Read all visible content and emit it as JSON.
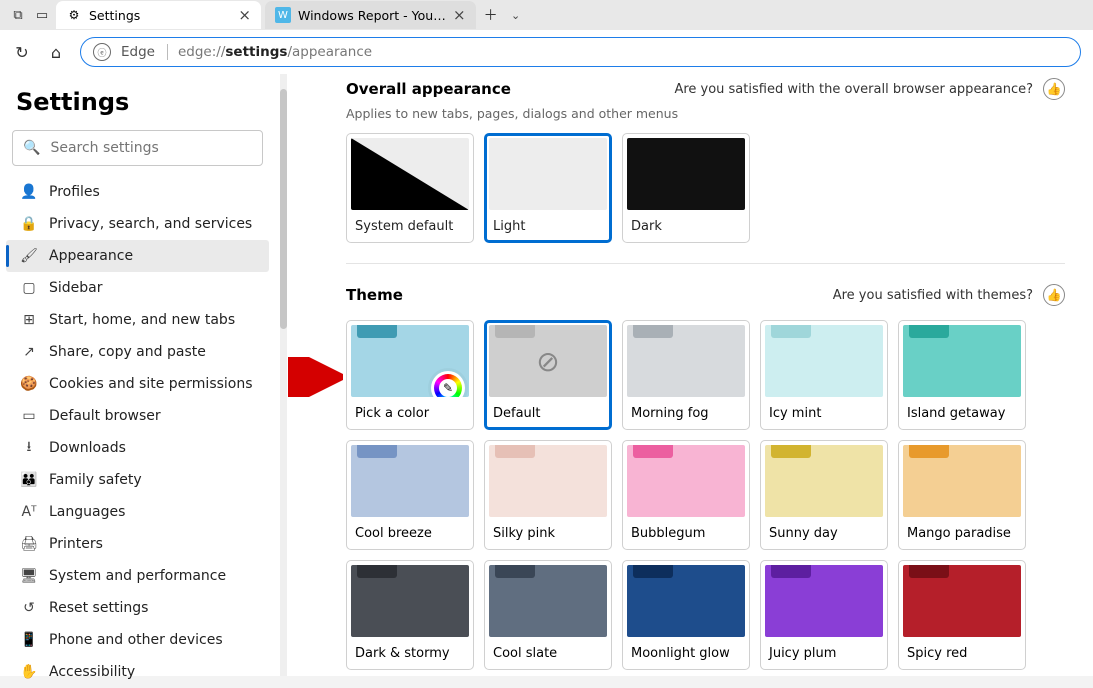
{
  "tabs": [
    {
      "title": "Settings",
      "active": true
    },
    {
      "title": "Windows Report - Your go-to so",
      "active": false
    }
  ],
  "url": {
    "prefix_label": "Edge",
    "scheme": "edge://",
    "bold": "settings",
    "rest": "/appearance"
  },
  "sidebar": {
    "title": "Settings",
    "search_placeholder": "Search settings",
    "items": [
      {
        "label": "Profiles"
      },
      {
        "label": "Privacy, search, and services"
      },
      {
        "label": "Appearance",
        "active": true
      },
      {
        "label": "Sidebar"
      },
      {
        "label": "Start, home, and new tabs"
      },
      {
        "label": "Share, copy and paste"
      },
      {
        "label": "Cookies and site permissions"
      },
      {
        "label": "Default browser"
      },
      {
        "label": "Downloads"
      },
      {
        "label": "Family safety"
      },
      {
        "label": "Languages"
      },
      {
        "label": "Printers"
      },
      {
        "label": "System and performance"
      },
      {
        "label": "Reset settings"
      },
      {
        "label": "Phone and other devices"
      },
      {
        "label": "Accessibility"
      }
    ]
  },
  "overall": {
    "title": "Overall appearance",
    "feedback": "Are you satisfied with the overall browser appearance?",
    "subtitle": "Applies to new tabs, pages, dialogs and other menus",
    "options": [
      {
        "label": "System default"
      },
      {
        "label": "Light",
        "selected": true
      },
      {
        "label": "Dark"
      }
    ]
  },
  "theme": {
    "title": "Theme",
    "feedback": "Are you satisfied with themes?",
    "items": [
      {
        "label": "Pick a color",
        "bg": "#a4d6e6",
        "tab": "#3f9bb3",
        "picker": true
      },
      {
        "label": "Default",
        "bg": "#cfcfcf",
        "tab": "#b5b5b5",
        "nope": true,
        "selected": true
      },
      {
        "label": "Morning fog",
        "bg": "#d7dadd",
        "tab": "#a9b0b6"
      },
      {
        "label": "Icy mint",
        "bg": "#cdeef0",
        "tab": "#9fd6da"
      },
      {
        "label": "Island getaway",
        "bg": "#69d0c6",
        "tab": "#2aa99c"
      },
      {
        "label": "Cool breeze",
        "bg": "#b4c6e0",
        "tab": "#7694c4"
      },
      {
        "label": "Silky pink",
        "bg": "#f4e1db",
        "tab": "#e6c0b6"
      },
      {
        "label": "Bubblegum",
        "bg": "#f8b4d3",
        "tab": "#ec5fa0"
      },
      {
        "label": "Sunny day",
        "bg": "#efe3a7",
        "tab": "#d2b430"
      },
      {
        "label": "Mango paradise",
        "bg": "#f4cf93",
        "tab": "#e89a2c"
      },
      {
        "label": "Dark & stormy",
        "bg": "#4a4e55",
        "tab": "#2d3036"
      },
      {
        "label": "Cool slate",
        "bg": "#606e80",
        "tab": "#3a4656"
      },
      {
        "label": "Moonlight glow",
        "bg": "#1e4d8c",
        "tab": "#0d2e5c"
      },
      {
        "label": "Juicy plum",
        "bg": "#8a3ed6",
        "tab": "#5d1fa0"
      },
      {
        "label": "Spicy red",
        "bg": "#b51f2a",
        "tab": "#7a0f17"
      }
    ]
  }
}
